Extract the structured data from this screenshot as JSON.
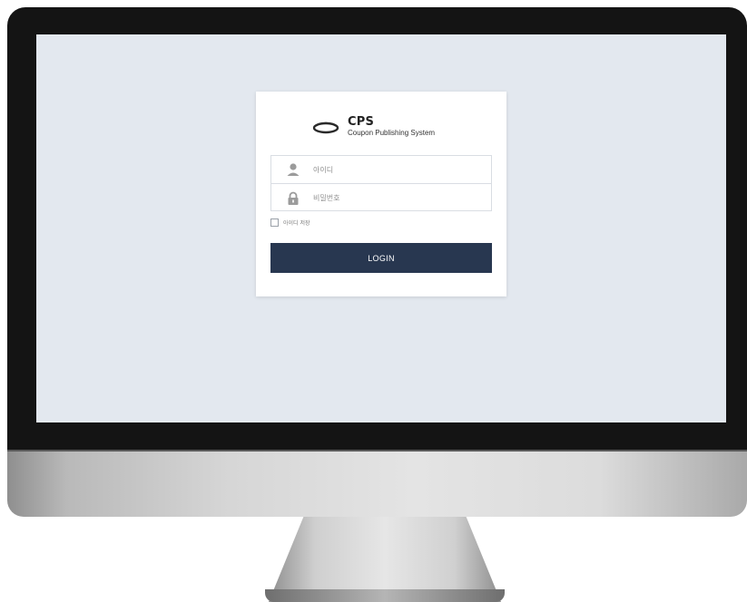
{
  "app": {
    "title": "CPS",
    "subtitle": "Coupon Publishing System"
  },
  "login_form": {
    "username_placeholder": "아이디",
    "password_placeholder": "비밀번호",
    "remember_label": "아이디 저장",
    "remember_checked": false,
    "login_button_label": "LOGIN"
  },
  "icons": {
    "logo": "cps-logo-icon",
    "username": "user-icon",
    "password": "lock-icon"
  },
  "colors": {
    "screen_background": "#e3e8ef",
    "button_background": "#283750",
    "button_text": "#ffffff",
    "icon_gray": "#9b9b9b"
  }
}
